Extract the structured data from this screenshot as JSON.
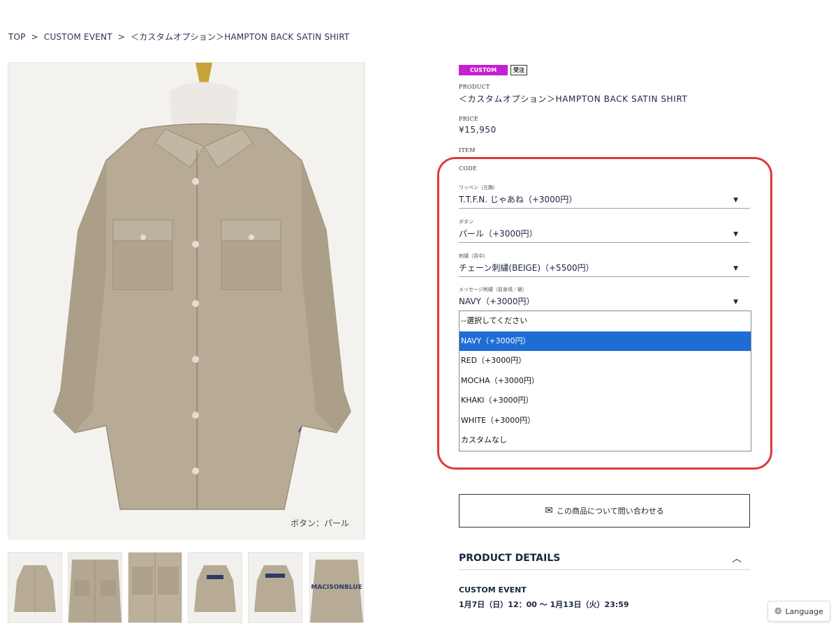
{
  "breadcrumb": {
    "top": "TOP",
    "sep": ">",
    "event": "CUSTOM EVENT",
    "current": "＜カスタムオプション＞HAMPTON BACK SATIN SHIRT"
  },
  "image": {
    "caption": "ボタン：パール",
    "thumb_text": "MACISONBLUE"
  },
  "badges": {
    "custom": "CUSTOM",
    "order": "受注"
  },
  "product": {
    "label": "PRODUCT",
    "name": "＜カスタムオプション＞HAMPTON BACK SATIN SHIRT",
    "price_label": "PRICE",
    "price": "¥15,950",
    "item_label": "ITEM",
    "code_label": "CODE"
  },
  "options": [
    {
      "label": "ワッペン（左胸）",
      "value": "T.T.F.N. じゃあね（+3000円）"
    },
    {
      "label": "ボタン",
      "value": "パール（+3000円）"
    },
    {
      "label": "刺繍（背中）",
      "value": "チェーン刺繍(BEIGE)（+5500円）"
    },
    {
      "label": "メッセージ刺繍（前身頃／裾）",
      "value": "NAVY（+3000円）"
    }
  ],
  "dropdown_options": [
    "--選択してください",
    "NAVY（+3000円）",
    "RED（+3000円）",
    "MOCHA（+3000円）",
    "KHAKI（+3000円）",
    "WHITE（+3000円）",
    "カスタムなし"
  ],
  "dropdown_selected_index": 1,
  "inquiry": {
    "label": "この商品について問い合わせる",
    "icon": "mail-icon"
  },
  "details": {
    "heading": "PRODUCT DETAILS",
    "event_title": "CUSTOM EVENT",
    "event_date": "1月7日（日）12：00 ～ 1月13日（火）23:59"
  },
  "language": {
    "label": "Language",
    "icon": "globe-icon"
  },
  "colors": {
    "custom_badge": "#c41fd0",
    "selected_option": "#1f6dd4",
    "highlight": "#e0383b",
    "text_navy": "#1a2540",
    "shirt": "#b7ab96"
  }
}
